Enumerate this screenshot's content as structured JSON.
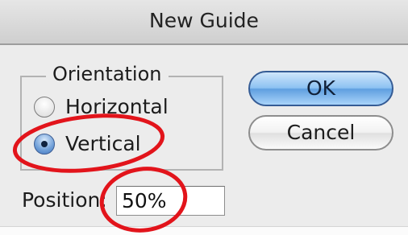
{
  "dialog": {
    "title": "New Guide"
  },
  "orientation": {
    "group_label": "Orientation",
    "options": [
      {
        "label": "Horizontal",
        "selected": false
      },
      {
        "label": "Vertical",
        "selected": true
      }
    ]
  },
  "buttons": {
    "ok_label": "OK",
    "cancel_label": "Cancel"
  },
  "position": {
    "label": "Position:",
    "value": "50%"
  },
  "colors": {
    "annotation": "#e2141b",
    "default_button": "#8dc2f2",
    "radio_selected": "#3f74be"
  }
}
